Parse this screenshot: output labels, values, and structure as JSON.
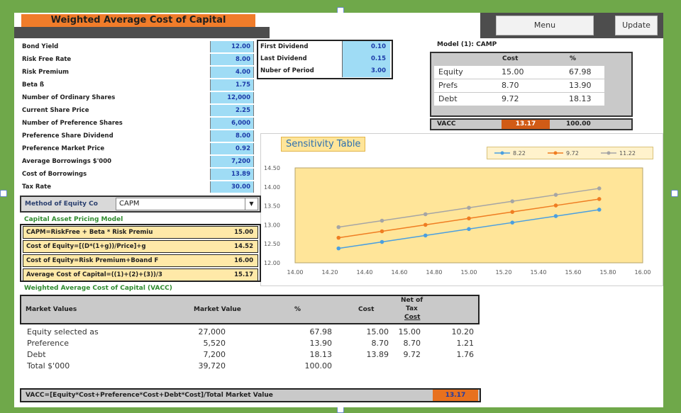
{
  "title": "Weighted Average Cost of Capital",
  "buttons": {
    "menu": "Menu",
    "update": "Update"
  },
  "inputs": [
    {
      "label": "Bond Yield",
      "value": "12.00"
    },
    {
      "label": "Risk Free Rate",
      "value": "8.00"
    },
    {
      "label": "Risk Premium",
      "value": "4.00"
    },
    {
      "label": "Beta ß",
      "value": "1.75"
    },
    {
      "label": "Number of Ordinary Shares",
      "value": "12,000"
    },
    {
      "label": "Current Share Price",
      "value": "2.25"
    },
    {
      "label": "Number of Preference Shares",
      "value": "6,000"
    },
    {
      "label": "Preference Share Dividend",
      "value": "8.00"
    },
    {
      "label": "Preference Market Price",
      "value": "0.92"
    },
    {
      "label": "Average Borrowings $'000",
      "value": "7,200"
    },
    {
      "label": "Cost of Borrowings",
      "value": "13.89"
    },
    {
      "label": "Tax Rate",
      "value": "30.00"
    }
  ],
  "dividends": [
    {
      "label": "First Dividend",
      "value": "0.10"
    },
    {
      "label": "Last Dividend",
      "value": "0.15"
    },
    {
      "label": "Nuber of Period",
      "value": "3.00"
    }
  ],
  "model": {
    "title": "Model (1): CAMP",
    "headers": {
      "cost": "Cost",
      "pct": "%"
    },
    "rows": [
      {
        "name": "Equity",
        "cost": "15.00",
        "pct": "67.98"
      },
      {
        "name": "Prefs",
        "cost": "8.70",
        "pct": "13.90"
      },
      {
        "name": "Debt",
        "cost": "9.72",
        "pct": "18.13"
      }
    ],
    "wacc_label": "VACC",
    "wacc_value": "13.17",
    "total_pct": "100.00"
  },
  "sensitivity": {
    "title": "Sensitivity Table"
  },
  "method": {
    "label": "Method of Equity Co",
    "selected": "CAPM"
  },
  "capm": {
    "title": "Capital Asset Pricing Model",
    "rows": [
      {
        "label": "CAPM=RiskFree + Beta * Risk Premiu",
        "value": "15.00"
      },
      {
        "label": "Cost of Equity=[(D*(1+g))/Price]+g",
        "value": "14.52"
      },
      {
        "label": "Cost of Equity=Risk Premium+Boand F",
        "value": "16.00"
      },
      {
        "label": "Average Cost of Capital=((1)+(2)+(3))/3",
        "value": "15.17"
      }
    ]
  },
  "wacc_table": {
    "title": "Weighted Average Cost of Capital (VACC)",
    "headers": {
      "market_values": "Market Values",
      "market_value": "Market Value",
      "pct": "%",
      "cost": "Cost",
      "net_tax_line1": "Net of",
      "net_tax_line2": "Tax",
      "net_tax_line3": "Cost"
    },
    "rows": [
      {
        "name": "Equity selected as",
        "mv": "27,000",
        "pct": "67.98",
        "cost": "15.00",
        "net": "15.00",
        "w": "10.20"
      },
      {
        "name": "Preference",
        "mv": "5,520",
        "pct": "13.90",
        "cost": "8.70",
        "net": "8.70",
        "w": "1.21"
      },
      {
        "name": "Debt",
        "mv": "7,200",
        "pct": "18.13",
        "cost": "13.89",
        "net": "9.72",
        "w": "1.76"
      },
      {
        "name": "Total $'000",
        "mv": "39,720",
        "pct": "100.00",
        "cost": "",
        "net": "",
        "w": ""
      }
    ],
    "footer_label": "VACC=[Equity*Cost+Preference*Cost+Debt*Cost]/Total Market Value",
    "footer_value": "13.17"
  },
  "chart_data": {
    "type": "line",
    "title": "Sensitivity Table",
    "xlim": [
      14.0,
      16.0
    ],
    "ylim": [
      12.0,
      14.5
    ],
    "xticks": [
      "14.00",
      "14.20",
      "14.40",
      "14.60",
      "14.80",
      "15.00",
      "15.20",
      "15.40",
      "15.60",
      "15.80",
      "16.00"
    ],
    "yticks": [
      "12.00",
      "12.50",
      "13.00",
      "13.50",
      "14.00",
      "14.50"
    ],
    "x": [
      14.25,
      14.5,
      14.75,
      15.0,
      15.25,
      15.5,
      15.75
    ],
    "series": [
      {
        "name": "8.22",
        "color": "#4a9fe0",
        "values": [
          12.38,
          12.55,
          12.72,
          12.89,
          13.06,
          13.23,
          13.4
        ]
      },
      {
        "name": "9.72",
        "color": "#ef7d22",
        "values": [
          12.66,
          12.83,
          13.0,
          13.17,
          13.34,
          13.51,
          13.68
        ]
      },
      {
        "name": "11.22",
        "color": "#a5a5a5",
        "values": [
          12.94,
          13.11,
          13.28,
          13.45,
          13.62,
          13.79,
          13.96
        ]
      }
    ],
    "legend": "top-right",
    "grid": false,
    "plot_background": "#ffe599"
  }
}
